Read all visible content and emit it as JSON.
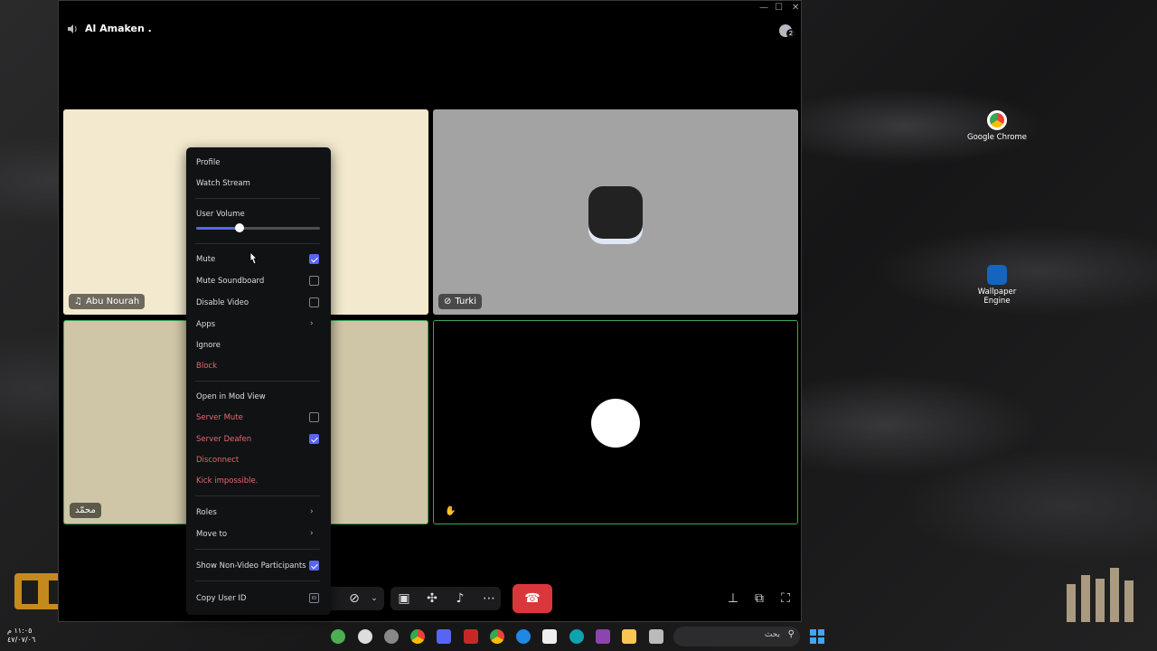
{
  "window": {
    "channel_name": "Al Amaken .",
    "controls": {
      "minimize": "—",
      "maximize": "☐",
      "close": "✕"
    },
    "notification_count": "2"
  },
  "tiles": [
    {
      "name": "Abu Nourah"
    },
    {
      "name": "Turki"
    },
    {
      "name": "محمّد"
    },
    {
      "name": ""
    }
  ],
  "context_menu": {
    "profile": "Profile",
    "watch_stream": "Watch Stream",
    "user_volume": "User Volume",
    "volume_level": 0.35,
    "mute": "Mute",
    "mute_soundboard": "Mute Soundboard",
    "disable_video": "Disable Video",
    "apps": "Apps",
    "ignore": "Ignore",
    "block": "Block",
    "open_in_mod_view": "Open in Mod View",
    "server_mute": "Server Mute",
    "server_deafen": "Server Deafen",
    "disconnect": "Disconnect",
    "kick": "Kick impossible.",
    "roles": "Roles",
    "move_to": "Move to",
    "show_non_video": "Show Non-Video Participants",
    "copy_user_id": "Copy User ID",
    "id_badge": "ID",
    "checked": {
      "mute": true,
      "mute_soundboard": false,
      "disable_video": false,
      "server_mute": false,
      "server_deafen": true,
      "show_non_video": true
    }
  },
  "desktop": {
    "icons": [
      {
        "label": "Google Chrome",
        "icon": "chrome-icon"
      },
      {
        "label": "Wallpaper Engine",
        "icon": "wallpaper-engine-icon"
      }
    ]
  },
  "taskbar": {
    "search_placeholder": "بحث",
    "clock_time": "١١:٠٥ م",
    "clock_date": "٤٧/٠٧/٠٦"
  },
  "colors": {
    "accent": "#5865f2",
    "danger": "#f0474f",
    "hangup": "#da373c",
    "tile_cream": "#f2e9ce",
    "tile_tan": "#cfc6a7",
    "tile_gray": "#a3a3a3",
    "speaking_border": "#3ba55d"
  }
}
